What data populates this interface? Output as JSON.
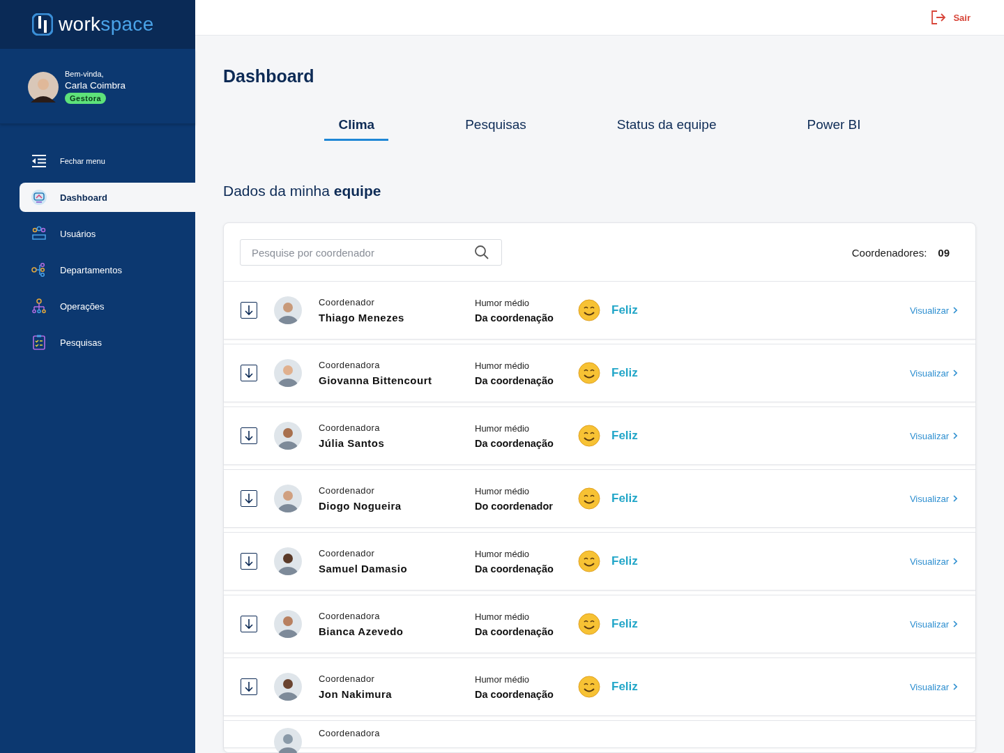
{
  "logo": {
    "parts": [
      "work",
      "space"
    ]
  },
  "user": {
    "greeting": "Bem-vinda,",
    "name": "Carla Coimbra",
    "role": "Gestora"
  },
  "menu_toggle": "Fechar menu",
  "nav": [
    {
      "label": "Dashboard",
      "selected": true
    },
    {
      "label": "Usuários",
      "selected": false
    },
    {
      "label": "Departamentos",
      "selected": false
    },
    {
      "label": "Operações",
      "selected": false
    },
    {
      "label": "Pesquisas",
      "selected": false
    }
  ],
  "header": {
    "logout": "Sair"
  },
  "title": "Dashboard",
  "tabs": [
    {
      "label": "Clima",
      "selected": true
    },
    {
      "label": "Pesquisas",
      "selected": false
    },
    {
      "label": "Status da equipe",
      "selected": false
    },
    {
      "label": "Power BI",
      "selected": false
    }
  ],
  "section_title": "Dados da minha **equipe**",
  "search": {
    "placeholder": "Pesquise por coordenador"
  },
  "count": {
    "label": "Coordenadores:",
    "value": "09"
  },
  "rows": [
    {
      "role": "Coordenador",
      "name": "Thiago Menezes",
      "mood_label": "Humor médio",
      "mood_scope": "Da coordenação",
      "mood": "Feliz",
      "action": "Visualizar"
    },
    {
      "role": "Coordenadora",
      "name": "Giovanna Bittencourt",
      "mood_label": "Humor médio",
      "mood_scope": "Da coordenação",
      "mood": "Feliz",
      "action": "Visualizar"
    },
    {
      "role": "Coordenadora",
      "name": "Júlia Santos",
      "mood_label": "Humor médio",
      "mood_scope": "Da coordenação",
      "mood": "Feliz",
      "action": "Visualizar"
    },
    {
      "role": "Coordenador",
      "name": "Diogo Nogueira",
      "mood_label": "Humor médio",
      "mood_scope": "Do coordenador",
      "mood": "Feliz",
      "action": "Visualizar"
    },
    {
      "role": "Coordenador",
      "name": "Samuel Damasio",
      "mood_label": "Humor médio",
      "mood_scope": "Da coordenação",
      "mood": "Feliz",
      "action": "Visualizar"
    },
    {
      "role": "Coordenadora",
      "name": "Bianca Azevedo",
      "mood_label": "Humor médio",
      "mood_scope": "Da coordenação",
      "mood": "Feliz",
      "action": "Visualizar"
    },
    {
      "role": "Coordenador",
      "name": "Jon Nakimura",
      "mood_label": "Humor médio",
      "mood_scope": "Da coordenação",
      "mood": "Feliz",
      "action": "Visualizar"
    }
  ],
  "partial_row": {
    "role": "Coordenadora"
  }
}
